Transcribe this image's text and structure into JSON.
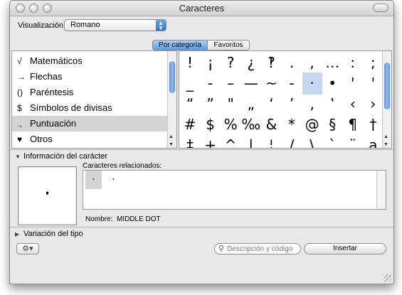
{
  "window": {
    "title": "Caracteres"
  },
  "view": {
    "label": "Visualización:",
    "selected": "Romano"
  },
  "tabs": [
    {
      "label": "Por categoría",
      "selected": true
    },
    {
      "label": "Favoritos",
      "selected": false
    }
  ],
  "categories": [
    {
      "icon": "√",
      "label": "Matemáticos"
    },
    {
      "icon": "→",
      "label": "Flechas"
    },
    {
      "icon": "()",
      "label": "Paréntesis"
    },
    {
      "icon": "$",
      "label": "Símbolos de divisas"
    },
    {
      "icon": ".,",
      "label": "Puntuación"
    },
    {
      "icon": "♥",
      "label": "Otros"
    }
  ],
  "selected_category": "Puntuación",
  "glyphs": [
    [
      "!",
      "¡",
      "?",
      "¿",
      "‽",
      ".",
      ",",
      "…",
      ":",
      ";"
    ],
    [
      "_",
      "‐",
      "–",
      "—",
      "~",
      "-",
      "·",
      "•",
      "'",
      "'"
    ],
    [
      "“",
      "”",
      "\"",
      "„",
      "‘",
      "’",
      "‚",
      "‛",
      "‹",
      "›"
    ],
    [
      "#",
      "$",
      "%",
      "‰",
      "&",
      "*",
      "@",
      "§",
      "¶",
      "†"
    ],
    [
      "‡",
      "+",
      "^",
      "|",
      "¦",
      "/",
      "\\",
      "`",
      "¨",
      "a"
    ]
  ],
  "selected_glyph": "·",
  "info": {
    "header": "Información del carácter",
    "preview": "·",
    "related_label": "Caracteres relacionados:",
    "related": [
      "·",
      "·"
    ],
    "name_label": "Nombre:",
    "name_value": "MIDDLE DOT"
  },
  "variation": {
    "header": "Variación del tipo"
  },
  "actions": {
    "gear": "⚙▾",
    "search_placeholder": "Descripción y código",
    "insert": "Insertar"
  }
}
